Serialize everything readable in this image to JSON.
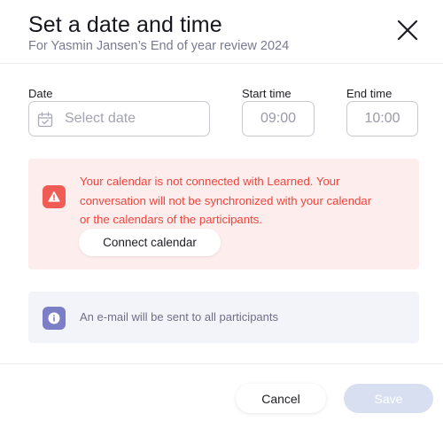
{
  "header": {
    "title": "Set a date and time",
    "subtitle": "For Yasmin Jansen’s End of year review 2024"
  },
  "form": {
    "date_label": "Date",
    "date_placeholder": "Select date",
    "start_label": "Start time",
    "start_value": "09:00",
    "end_label": "End time",
    "end_value": "10:00"
  },
  "alert": {
    "lines": [
      "Your calendar is not connected with Learned. Your",
      "conversation will not be synchronized with your calendar",
      "or the calendars of the participants."
    ],
    "button_label": "Connect calendar",
    "icon": "warning-triangle-icon",
    "color": "#f0443c"
  },
  "info": {
    "text": "An e-mail will be sent to all participants",
    "icon": "info-circle-icon",
    "color": "#7c7ec7"
  },
  "footer": {
    "cancel_label": "Cancel",
    "save_label": "Save"
  }
}
